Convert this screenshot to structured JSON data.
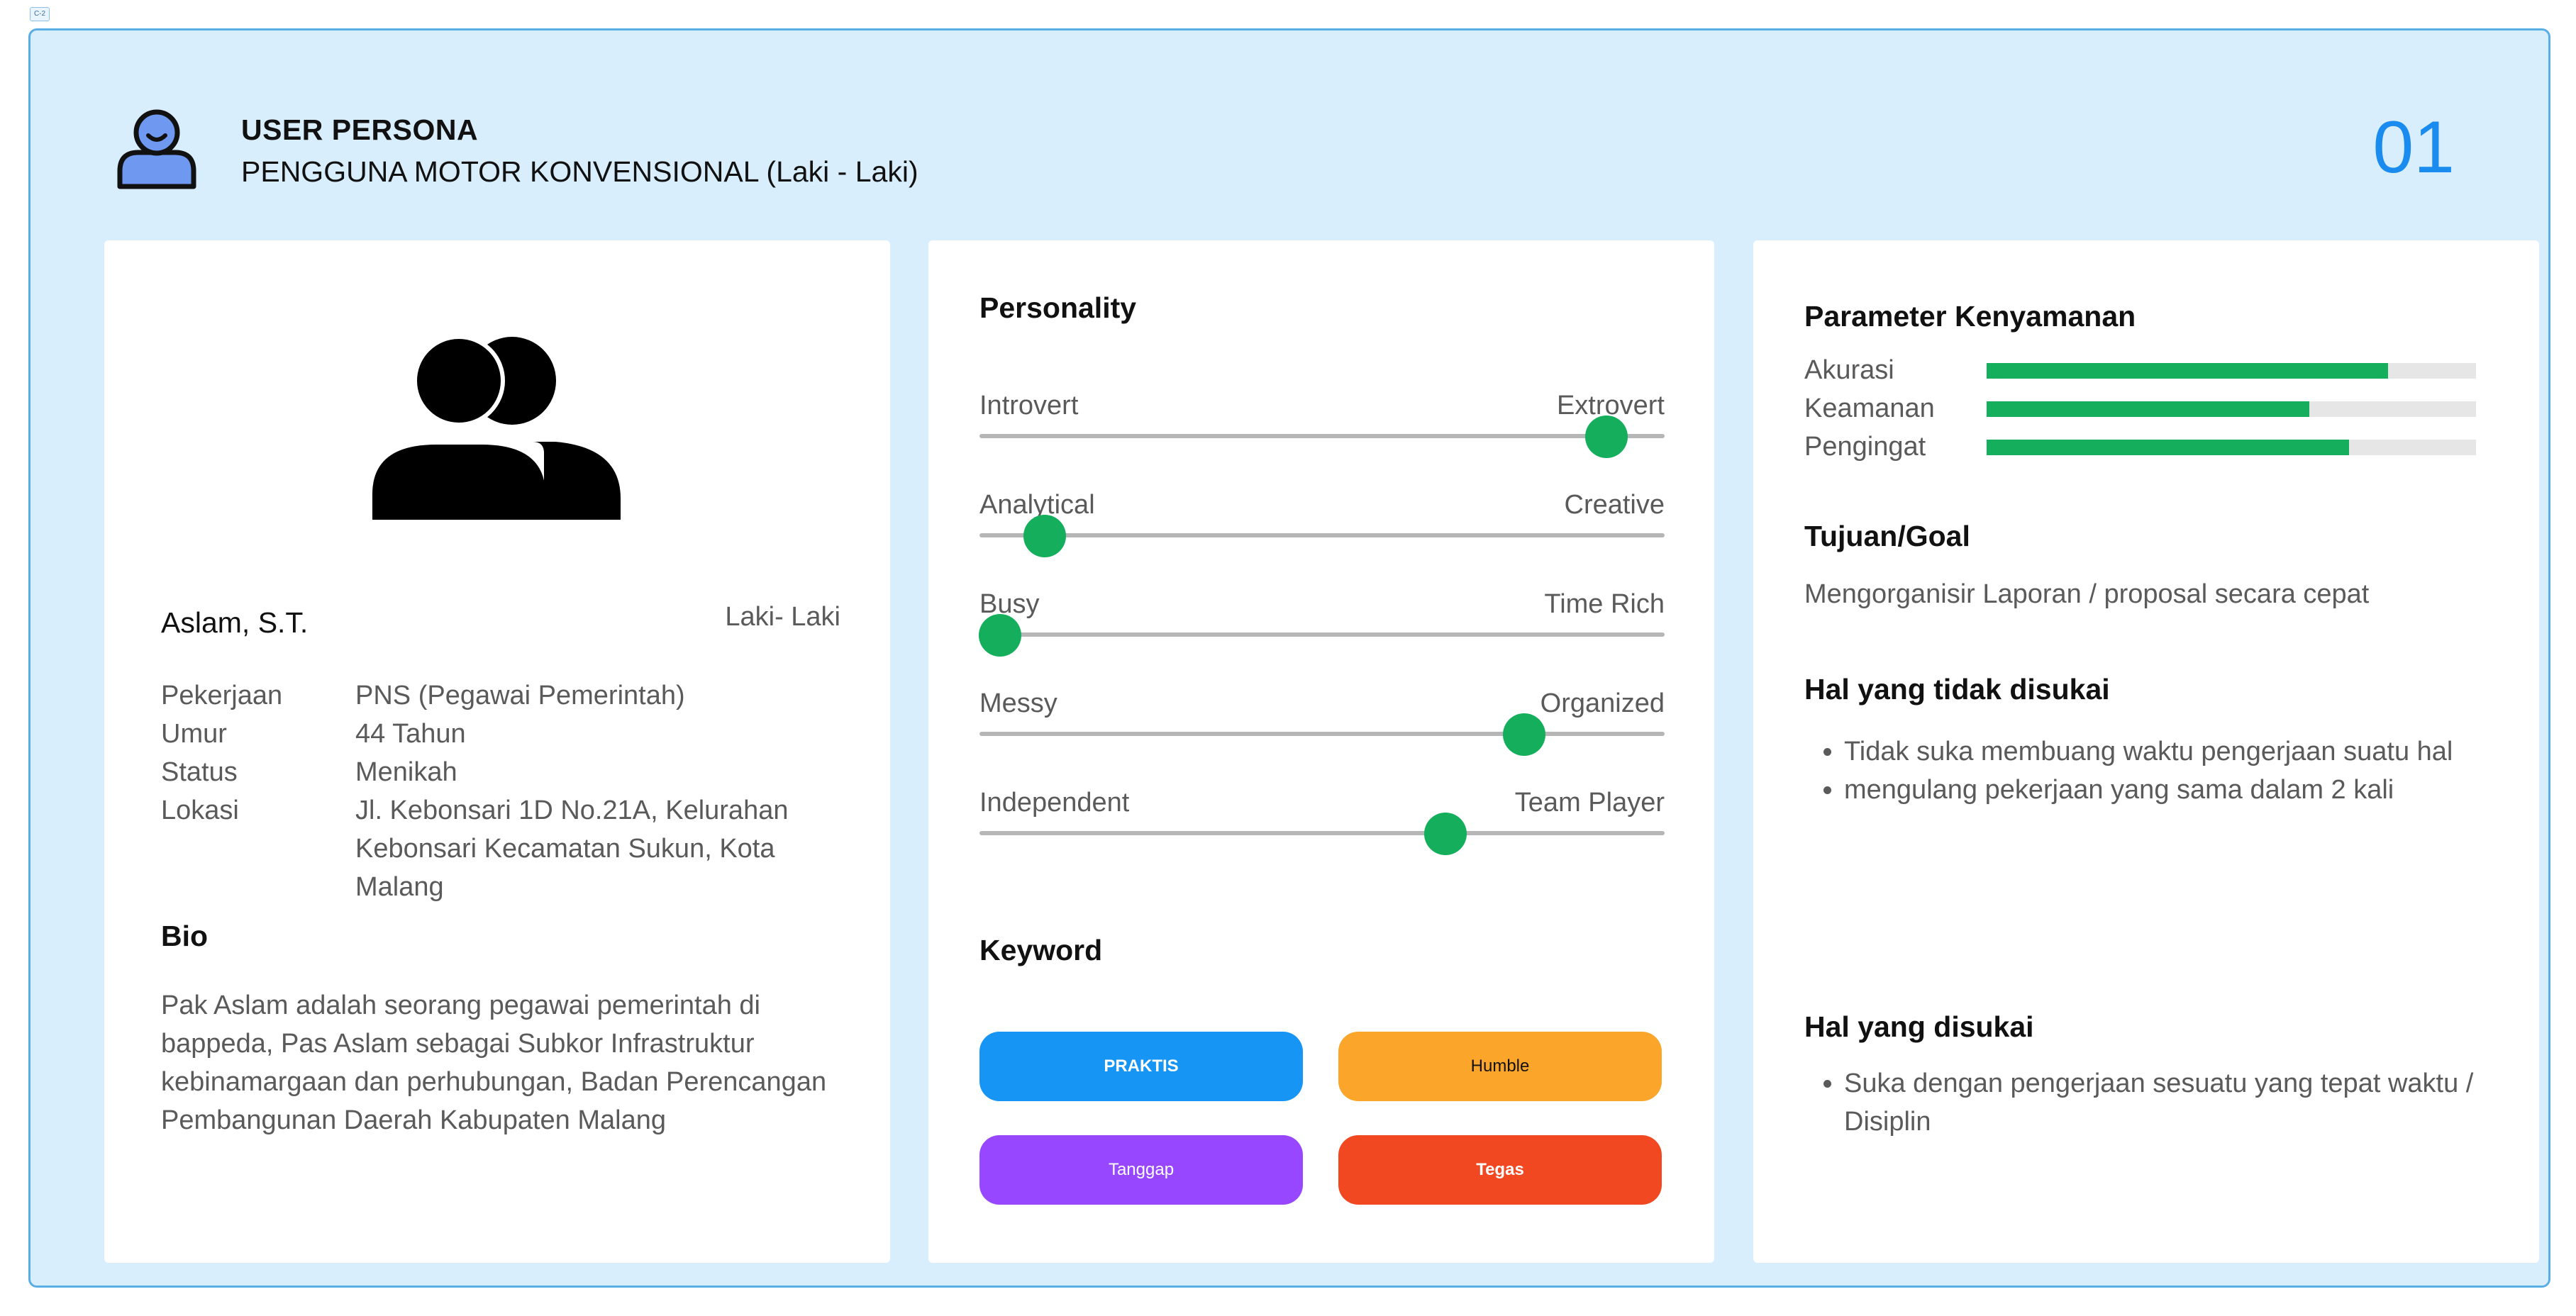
{
  "frame_tag": "C-2",
  "header": {
    "title": "USER PERSONA",
    "subtitle": "PENGGUNA MOTOR KONVENSIONAL (Laki - Laki)",
    "page_number": "01"
  },
  "profile": {
    "name": "Aslam, S.T.",
    "gender": "Laki- Laki",
    "info": [
      {
        "key": "Pekerjaan",
        "value": "PNS (Pegawai Pemerintah)"
      },
      {
        "key": "Umur",
        "value": "44 Tahun"
      },
      {
        "key": "Status",
        "value": "Menikah"
      },
      {
        "key": "Lokasi",
        "value": "Jl. Kebonsari 1D No.21A, Kelurahan Kebonsari Kecamatan Sukun, Kota Malang"
      }
    ],
    "bio_heading": "Bio",
    "bio_text": "Pak Aslam adalah seorang pegawai pemerintah di bappeda, Pas Aslam sebagai Subkor Infrastruktur kebinamargaan dan perhubungan, Badan Perencangan Pembangunan Daerah Kabupaten Malang"
  },
  "personality": {
    "heading": "Personality",
    "sliders": [
      {
        "left": "Introvert",
        "right": "Extrovert",
        "value": 0.915
      },
      {
        "left": "Analytical",
        "right": "Creative",
        "value": 0.095
      },
      {
        "left": "Busy",
        "right": "Time Rich",
        "value": 0.03
      },
      {
        "left": "Messy",
        "right": "Organized",
        "value": 0.795
      },
      {
        "left": "Independent",
        "right": "Team Player",
        "value": 0.68
      }
    ]
  },
  "keyword": {
    "heading": "Keyword",
    "items": [
      {
        "label": "PRAKTIS",
        "color": "#1795f5",
        "bold": true,
        "text_color": "#ffffff"
      },
      {
        "label": "Humble",
        "color": "#fba52a",
        "bold": false,
        "text_color": "#111111"
      },
      {
        "label": "Tanggap",
        "color": "#9747ff",
        "bold": false,
        "text_color": "#ffffff"
      },
      {
        "label": "Tegas",
        "color": "#f24822",
        "bold": true,
        "text_color": "#ffffff"
      }
    ]
  },
  "comfort": {
    "heading": "Parameter Kenyamanan",
    "params": [
      {
        "label": "Akurasi",
        "value": 0.82
      },
      {
        "label": "Keamanan",
        "value": 0.66
      },
      {
        "label": "Pengingat",
        "value": 0.74
      }
    ]
  },
  "goal": {
    "heading": "Tujuan/Goal",
    "text": "Mengorganisir Laporan / proposal secara cepat"
  },
  "dislikes": {
    "heading": "Hal yang tidak disukai",
    "items": [
      "Tidak suka membuang waktu pengerjaan suatu hal",
      "mengulang pekerjaan yang sama dalam 2 kali"
    ]
  },
  "likes": {
    "heading": "Hal yang disukai",
    "items": [
      "Suka dengan pengerjaan sesuatu yang  tepat waktu / Disiplin"
    ]
  },
  "colors": {
    "frame_bg": "#d9eefc",
    "frame_border": "#5aaee6",
    "accent_blue": "#1a8cf0",
    "knob_green": "#14ae5c",
    "avatar_fill": "#6f98f0"
  }
}
